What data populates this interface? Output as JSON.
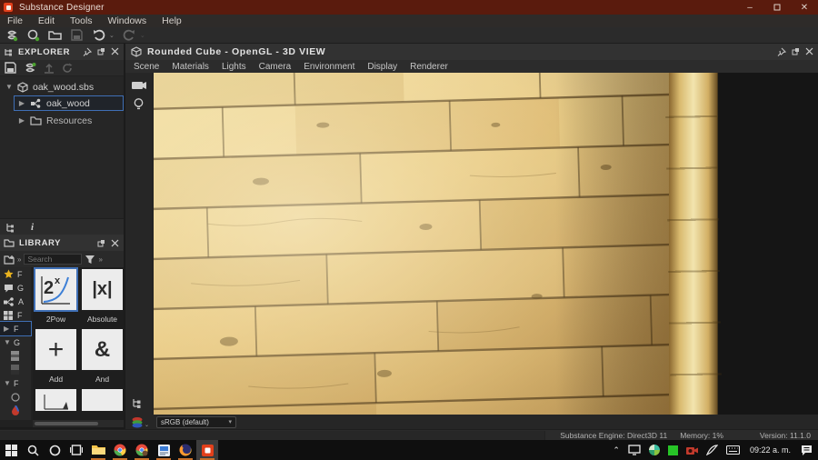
{
  "window": {
    "title": "Substance Designer",
    "minimize": "–",
    "close": "✕"
  },
  "menubar": {
    "items": [
      "File",
      "Edit",
      "Tools",
      "Windows",
      "Help"
    ]
  },
  "toolbar": {
    "icons": [
      "new-substance",
      "new-package",
      "open-folder",
      "save",
      "undo",
      "redo"
    ]
  },
  "explorer": {
    "title": "EXPLORER",
    "tree": [
      {
        "label": "oak_wood.sbs"
      },
      {
        "label": "oak_wood"
      },
      {
        "label": "Resources"
      }
    ]
  },
  "library": {
    "title": "LIBRARY",
    "search_placeholder": "Search",
    "categories": [
      "F",
      "G",
      "A",
      "F",
      "F",
      "G",
      "F"
    ],
    "items": [
      {
        "label": "2Pow",
        "glyph_base": "2",
        "glyph_sup": "x"
      },
      {
        "label": "Absolute",
        "glyph": "|x|"
      },
      {
        "label": "Add",
        "glyph": "+"
      },
      {
        "label": "And",
        "glyph": "&"
      }
    ]
  },
  "viewport3d": {
    "title": "Rounded Cube - OpenGL - 3D VIEW",
    "menu": [
      "Scene",
      "Materials",
      "Lights",
      "Camera",
      "Environment",
      "Display",
      "Renderer"
    ],
    "color_profile": "sRGB (default)",
    "dropdown_arrow": "▾"
  },
  "statusbar": {
    "engine": "Substance Engine: Direct3D 11",
    "memory": "Memory: 1%",
    "version": "Version: 11.1.0"
  },
  "taskbar": {
    "time": "09:22 a. m."
  },
  "colors": {
    "accent_orange": "#e2401b",
    "selection_blue": "#3f6fb5",
    "titlebar": "#5a1b0d",
    "wood_light": "#f2e4ae",
    "wood_dark": "#bd934e"
  }
}
